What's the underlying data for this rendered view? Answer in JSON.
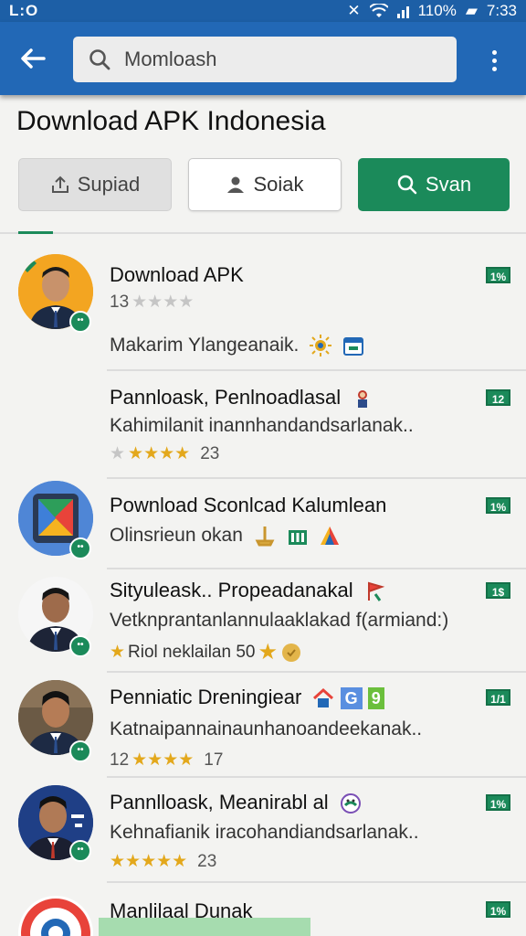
{
  "status_bar": {
    "left_icons": "L:O",
    "battery": "110%",
    "time": "7:33"
  },
  "toolbar": {
    "back_icon": "arrow-left-icon",
    "search_placeholder": "Momloash",
    "search_value": "Momloash",
    "more_icon": "more-vertical-icon"
  },
  "page": {
    "title": "Download APK Indonesia"
  },
  "actions": [
    {
      "label": "Supiad",
      "icon": "upload-icon"
    },
    {
      "label": "Soiak",
      "icon": "person-icon"
    },
    {
      "label": "Svan",
      "icon": "search-icon"
    }
  ],
  "items": [
    {
      "title": "Download APK",
      "rating_count": "13",
      "stars_on": 0,
      "stars_off": 4,
      "sub": "Makarim Ylangeanaik.",
      "badge": "1%"
    },
    {
      "title": "Pannloask, Penlnoadlasal",
      "sub": "Kahimilanit inannhandandsarlanak..",
      "stars_on": 4,
      "stars_off": 1,
      "rating": "23",
      "badge": "12"
    },
    {
      "title": "Pownload Sconlcad Kalumlean",
      "sub": "Olinsrieun okan",
      "badge": "1%"
    },
    {
      "title": "Sityuleask.. Propeadanakal",
      "sub": "Vetknprantanlannulaaklakad f(armiand:)",
      "meta": "Riol neklailan 50",
      "badge": "1$"
    },
    {
      "title": "Penniatic Dreningiear",
      "sub": "Katnaipannainaunhanoandeekanak..",
      "rating_count": "12",
      "stars_on": 4,
      "stars_off": 0,
      "rating": "17",
      "badge": "1/1"
    },
    {
      "title": "Pannlloask, Meanirabl al",
      "sub": "Kehnafianik iracohandiandsarlanak..",
      "stars_on": 5,
      "stars_off": 0,
      "rating": "23",
      "badge": "1%"
    },
    {
      "title": "Manlilaal Dunak",
      "badge": "1%"
    }
  ],
  "colors": {
    "primary": "#2268b6",
    "accent": "#1b8a5a",
    "star": "#e3a81c"
  }
}
